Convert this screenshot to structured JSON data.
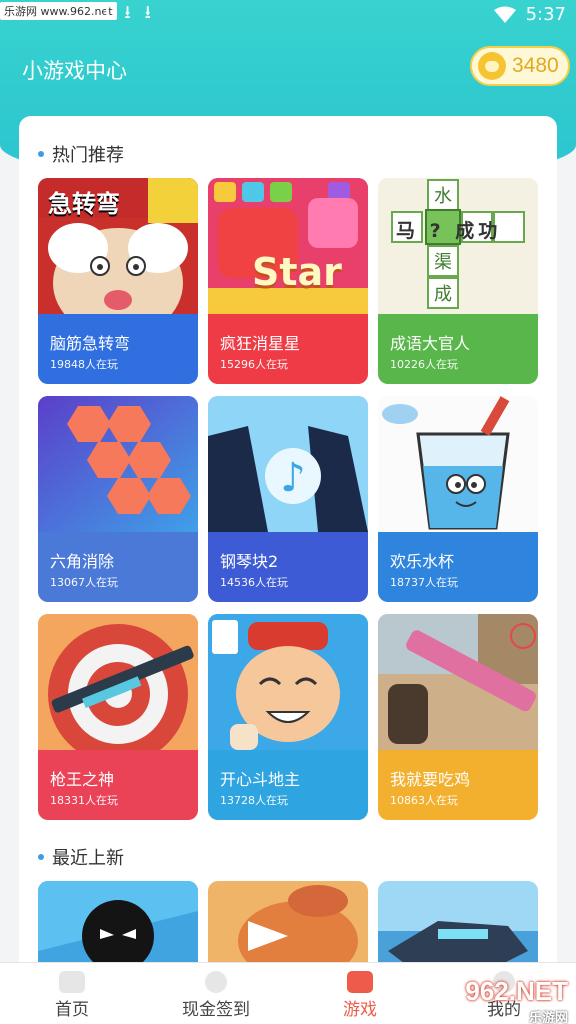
{
  "status_bar": {
    "watermark": "乐游网 www.962.net",
    "time": "5:37",
    "icons": [
      "notification-icon",
      "download-icon",
      "download-icon",
      "download-icon",
      "wifi-icon"
    ]
  },
  "header": {
    "title": "小游戏中心",
    "coin_value": "3480",
    "coin_icon": "coin-bag-icon"
  },
  "hot": {
    "title": "热门推荐",
    "games": [
      {
        "name": "脑筋急转弯",
        "players": "19848人在玩",
        "art_text": "急转弯",
        "color": "#2f6fe0"
      },
      {
        "name": "疯狂消星星",
        "players": "15296人在玩",
        "art_text": "Star",
        "color": "#ef3b45"
      },
      {
        "name": "成语大官人",
        "players": "10226人在玩",
        "art_text": "马 ? 成功",
        "color": "#59b64a"
      },
      {
        "name": "六角消除",
        "players": "13067人在玩",
        "art_text": "",
        "color": "#4b79d8"
      },
      {
        "name": "钢琴块2",
        "players": "14536人在玩",
        "art_text": "",
        "color": "#3e5bd6"
      },
      {
        "name": "欢乐水杯",
        "players": "18737人在玩",
        "art_text": "",
        "color": "#2f84dd"
      },
      {
        "name": "枪王之神",
        "players": "18331人在玩",
        "art_text": "",
        "color": "#ea4257"
      },
      {
        "name": "开心斗地主",
        "players": "13728人在玩",
        "art_text": "",
        "color": "#2ea4e0"
      },
      {
        "name": "我就要吃鸡",
        "players": "10863人在玩",
        "art_text": "",
        "color": "#f2b02e"
      }
    ]
  },
  "recent": {
    "title": "最近上新"
  },
  "bottom_nav": {
    "items": [
      {
        "label": "首页",
        "icon": "home-icon"
      },
      {
        "label": "现金签到",
        "icon": "cash-signin-icon"
      },
      {
        "label": "游戏",
        "icon": "gamepad-icon"
      },
      {
        "label": "我的",
        "icon": "profile-icon"
      }
    ],
    "active": "游戏"
  },
  "corner_watermark": {
    "brand": "962.NET",
    "sub": "乐游网"
  }
}
